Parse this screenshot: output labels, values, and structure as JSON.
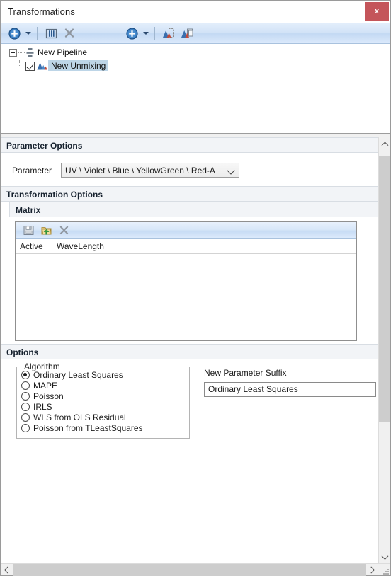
{
  "window": {
    "title": "Transformations",
    "close_label": "x"
  },
  "toolbar": {
    "buttons": [
      {
        "name": "add-pipeline-button",
        "icon": "plus-circle-icon",
        "label": "Add"
      },
      {
        "name": "add-pipeline-dropdown",
        "icon": "chevron-down-icon",
        "label": ""
      },
      {
        "name": "rename-button",
        "icon": "rename-text-icon",
        "label": "Rename"
      },
      {
        "name": "delete-button",
        "icon": "close-x-icon",
        "label": "Delete"
      },
      {
        "name": "add-transformation-button",
        "icon": "plus-circle-icon",
        "label": "Add Transformation"
      },
      {
        "name": "add-transformation-dropdown",
        "icon": "chevron-down-icon",
        "label": ""
      },
      {
        "name": "apply-transformation-button",
        "icon": "histogram-select-icon",
        "label": "Apply"
      },
      {
        "name": "copy-transformation-button",
        "icon": "histogram-copy-icon",
        "label": "Copy"
      }
    ]
  },
  "tree": {
    "root": {
      "label": "New Pipeline",
      "icon": "pipeline-icon",
      "expanded": true
    },
    "children": [
      {
        "label": "New Unmixing",
        "icon": "unmixing-histogram-icon",
        "checked": true,
        "selected": true
      }
    ]
  },
  "parameter_options": {
    "header": "Parameter Options",
    "parameter_label": "Parameter",
    "parameter_value": "UV \\ Violet \\ Blue \\ YellowGreen \\ Red-A"
  },
  "transformation_options": {
    "header": "Transformation Options",
    "matrix": {
      "header": "Matrix",
      "toolbar": [
        {
          "name": "save-matrix-button",
          "icon": "floppy-save-icon",
          "label": "Save"
        },
        {
          "name": "import-matrix-button",
          "icon": "folder-import-icon",
          "label": "Import"
        },
        {
          "name": "delete-matrix-button",
          "icon": "close-x-icon",
          "label": "Delete"
        }
      ],
      "columns": [
        "Active",
        "WaveLength"
      ],
      "rows": []
    }
  },
  "options": {
    "header": "Options",
    "algorithm": {
      "group_title": "Algorithm",
      "selected": "Ordinary Least Squares",
      "items": [
        "Ordinary Least Squares",
        "MAPE",
        "Poisson",
        "IRLS",
        "WLS from OLS Residual",
        "Poisson from TLeastSquares"
      ]
    },
    "suffix": {
      "label": "New Parameter Suffix",
      "value": "Ordinary Least Squares",
      "placeholder": ""
    }
  },
  "colors": {
    "accent_blue": "#2a6db5",
    "close_red": "#c4555a",
    "selection": "#bdd5e7",
    "toolbar_top": "#e3eefb",
    "scroll_thumb": "#cdcdcd"
  }
}
